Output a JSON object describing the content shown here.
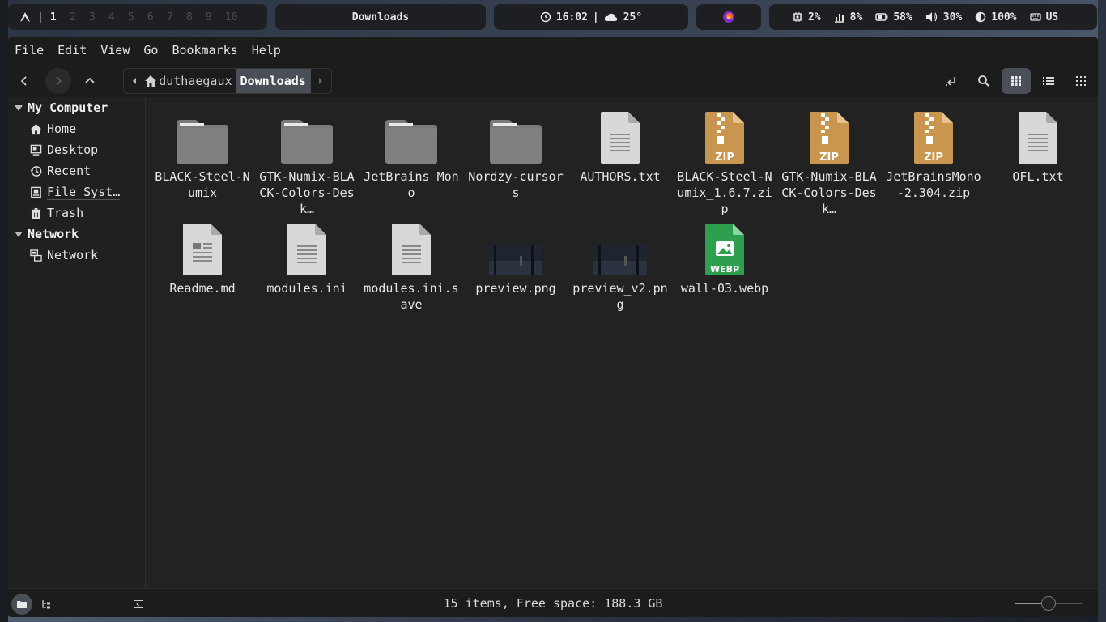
{
  "topbar": {
    "workspaces": [
      "1",
      "2",
      "3",
      "4",
      "5",
      "6",
      "7",
      "8",
      "9",
      "10"
    ],
    "active_workspace": "1",
    "separator": "|",
    "window_title": "Downloads",
    "time": "16:02",
    "clock_sep": "|",
    "weather": "25°",
    "cpu": "2%",
    "memory": "8%",
    "battery": "58%",
    "volume": "30%",
    "brightness": "100%",
    "keyboard_layout": "US"
  },
  "menu": [
    "File",
    "Edit",
    "View",
    "Go",
    "Bookmarks",
    "Help"
  ],
  "breadcrumb": {
    "home": "duthaegaux",
    "current": "Downloads"
  },
  "sidebar": {
    "sections": [
      {
        "title": "My Computer",
        "items": [
          {
            "label": "Home",
            "icon": "home-icon"
          },
          {
            "label": "Desktop",
            "icon": "desktop-icon"
          },
          {
            "label": "Recent",
            "icon": "recent-icon"
          },
          {
            "label": "File Syst…",
            "icon": "drive-icon"
          },
          {
            "label": "Trash",
            "icon": "trash-icon"
          }
        ]
      },
      {
        "title": "Network",
        "items": [
          {
            "label": "Network",
            "icon": "network-icon"
          }
        ]
      }
    ]
  },
  "files": [
    {
      "name": "BLACK-Steel-Numix",
      "type": "folder"
    },
    {
      "name": "GTK-Numix-BLACK-Colors-Desk…",
      "type": "folder"
    },
    {
      "name": "JetBrains Mono",
      "type": "folder"
    },
    {
      "name": "Nordzy-cursors",
      "type": "folder"
    },
    {
      "name": "AUTHORS.txt",
      "type": "text"
    },
    {
      "name": "BLACK-Steel-Numix_1.6.7.zip",
      "type": "zip"
    },
    {
      "name": "GTK-Numix-BLACK-Colors-Desk…",
      "type": "zip"
    },
    {
      "name": "JetBrainsMono-2.304.zip",
      "type": "zip"
    },
    {
      "name": "OFL.txt",
      "type": "text"
    },
    {
      "name": "Readme.md",
      "type": "markdown"
    },
    {
      "name": "modules.ini",
      "type": "text"
    },
    {
      "name": "modules.ini.save",
      "type": "text"
    },
    {
      "name": "preview.png",
      "type": "image"
    },
    {
      "name": "preview_v2.png",
      "type": "image"
    },
    {
      "name": "wall-03.webp",
      "type": "webp"
    }
  ],
  "file_badges": {
    "zip": "ZIP",
    "webp": "WEBP"
  },
  "status": {
    "text": "15 items, Free space: 188.3 GB",
    "zoom_level": 0.5
  },
  "colors": {
    "folder": "#7a7a7a",
    "zip": "#c8964f",
    "webp": "#2e9e4f",
    "selected": "#4a4f57"
  }
}
